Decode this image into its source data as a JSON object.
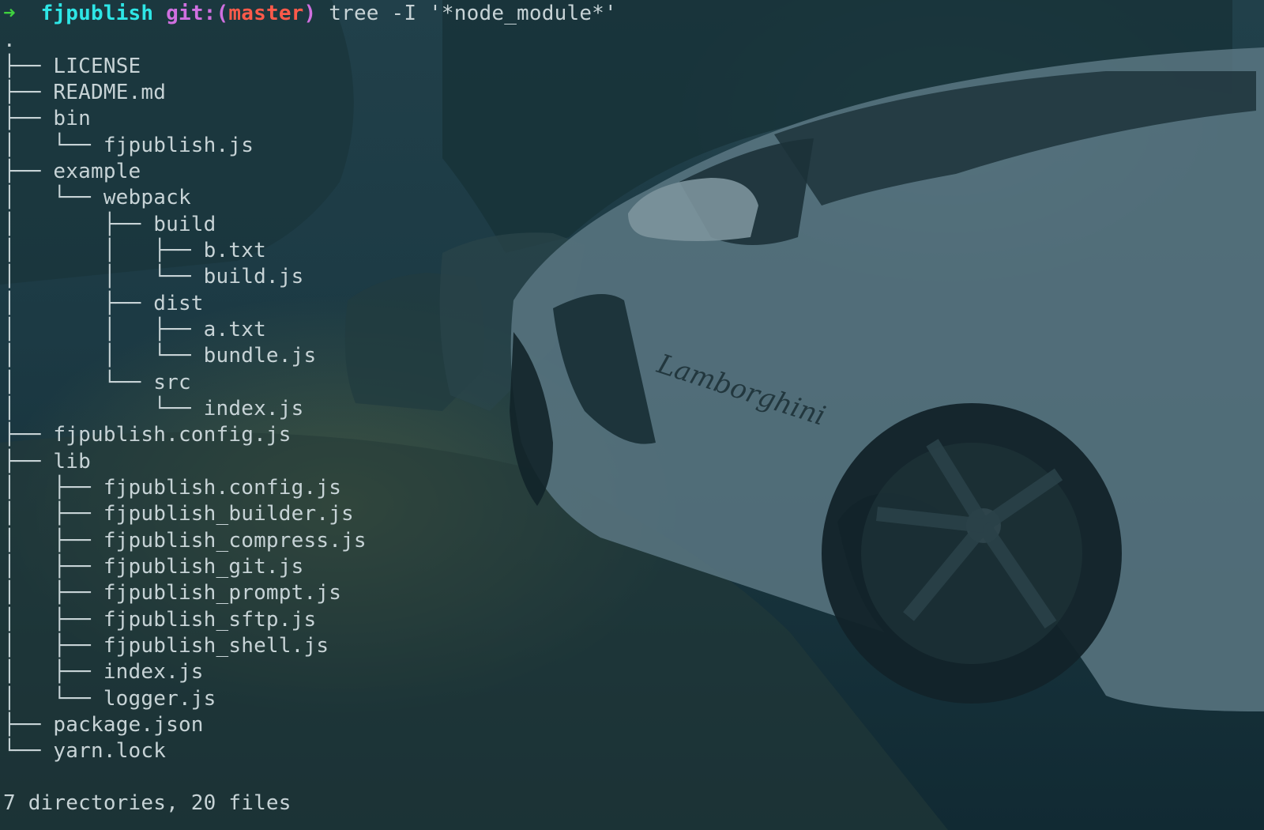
{
  "prompt": {
    "arrow": "➜",
    "directory": "fjpublish",
    "git_label": "git:(",
    "branch": "master",
    "git_close": ")",
    "command": "tree -I '*node_module*'"
  },
  "tree": {
    "root": ".",
    "entries": [
      {
        "prefix": "├── ",
        "name": "LICENSE"
      },
      {
        "prefix": "├── ",
        "name": "README.md"
      },
      {
        "prefix": "├── ",
        "name": "bin"
      },
      {
        "prefix": "│   └── ",
        "name": "fjpublish.js"
      },
      {
        "prefix": "├── ",
        "name": "example"
      },
      {
        "prefix": "│   └── ",
        "name": "webpack"
      },
      {
        "prefix": "│       ├── ",
        "name": "build"
      },
      {
        "prefix": "│       │   ├── ",
        "name": "b.txt"
      },
      {
        "prefix": "│       │   └── ",
        "name": "build.js"
      },
      {
        "prefix": "│       ├── ",
        "name": "dist"
      },
      {
        "prefix": "│       │   ├── ",
        "name": "a.txt"
      },
      {
        "prefix": "│       │   └── ",
        "name": "bundle.js"
      },
      {
        "prefix": "│       └── ",
        "name": "src"
      },
      {
        "prefix": "│           └── ",
        "name": "index.js"
      },
      {
        "prefix": "├── ",
        "name": "fjpublish.config.js"
      },
      {
        "prefix": "├── ",
        "name": "lib"
      },
      {
        "prefix": "│   ├── ",
        "name": "fjpublish.config.js"
      },
      {
        "prefix": "│   ├── ",
        "name": "fjpublish_builder.js"
      },
      {
        "prefix": "│   ├── ",
        "name": "fjpublish_compress.js"
      },
      {
        "prefix": "│   ├── ",
        "name": "fjpublish_git.js"
      },
      {
        "prefix": "│   ├── ",
        "name": "fjpublish_prompt.js"
      },
      {
        "prefix": "│   ├── ",
        "name": "fjpublish_sftp.js"
      },
      {
        "prefix": "│   ├── ",
        "name": "fjpublish_shell.js"
      },
      {
        "prefix": "│   ├── ",
        "name": "index.js"
      },
      {
        "prefix": "│   └── ",
        "name": "logger.js"
      },
      {
        "prefix": "├── ",
        "name": "package.json"
      },
      {
        "prefix": "└── ",
        "name": "yarn.lock"
      }
    ]
  },
  "summary": "7 directories, 20 files",
  "colors": {
    "prompt_arrow": "#3fd13f",
    "prompt_directory": "#2ee6e6",
    "prompt_git": "#d070e0",
    "prompt_branch": "#ff5a4a",
    "text": "#c7d3d6",
    "background": "#1c3a44"
  }
}
